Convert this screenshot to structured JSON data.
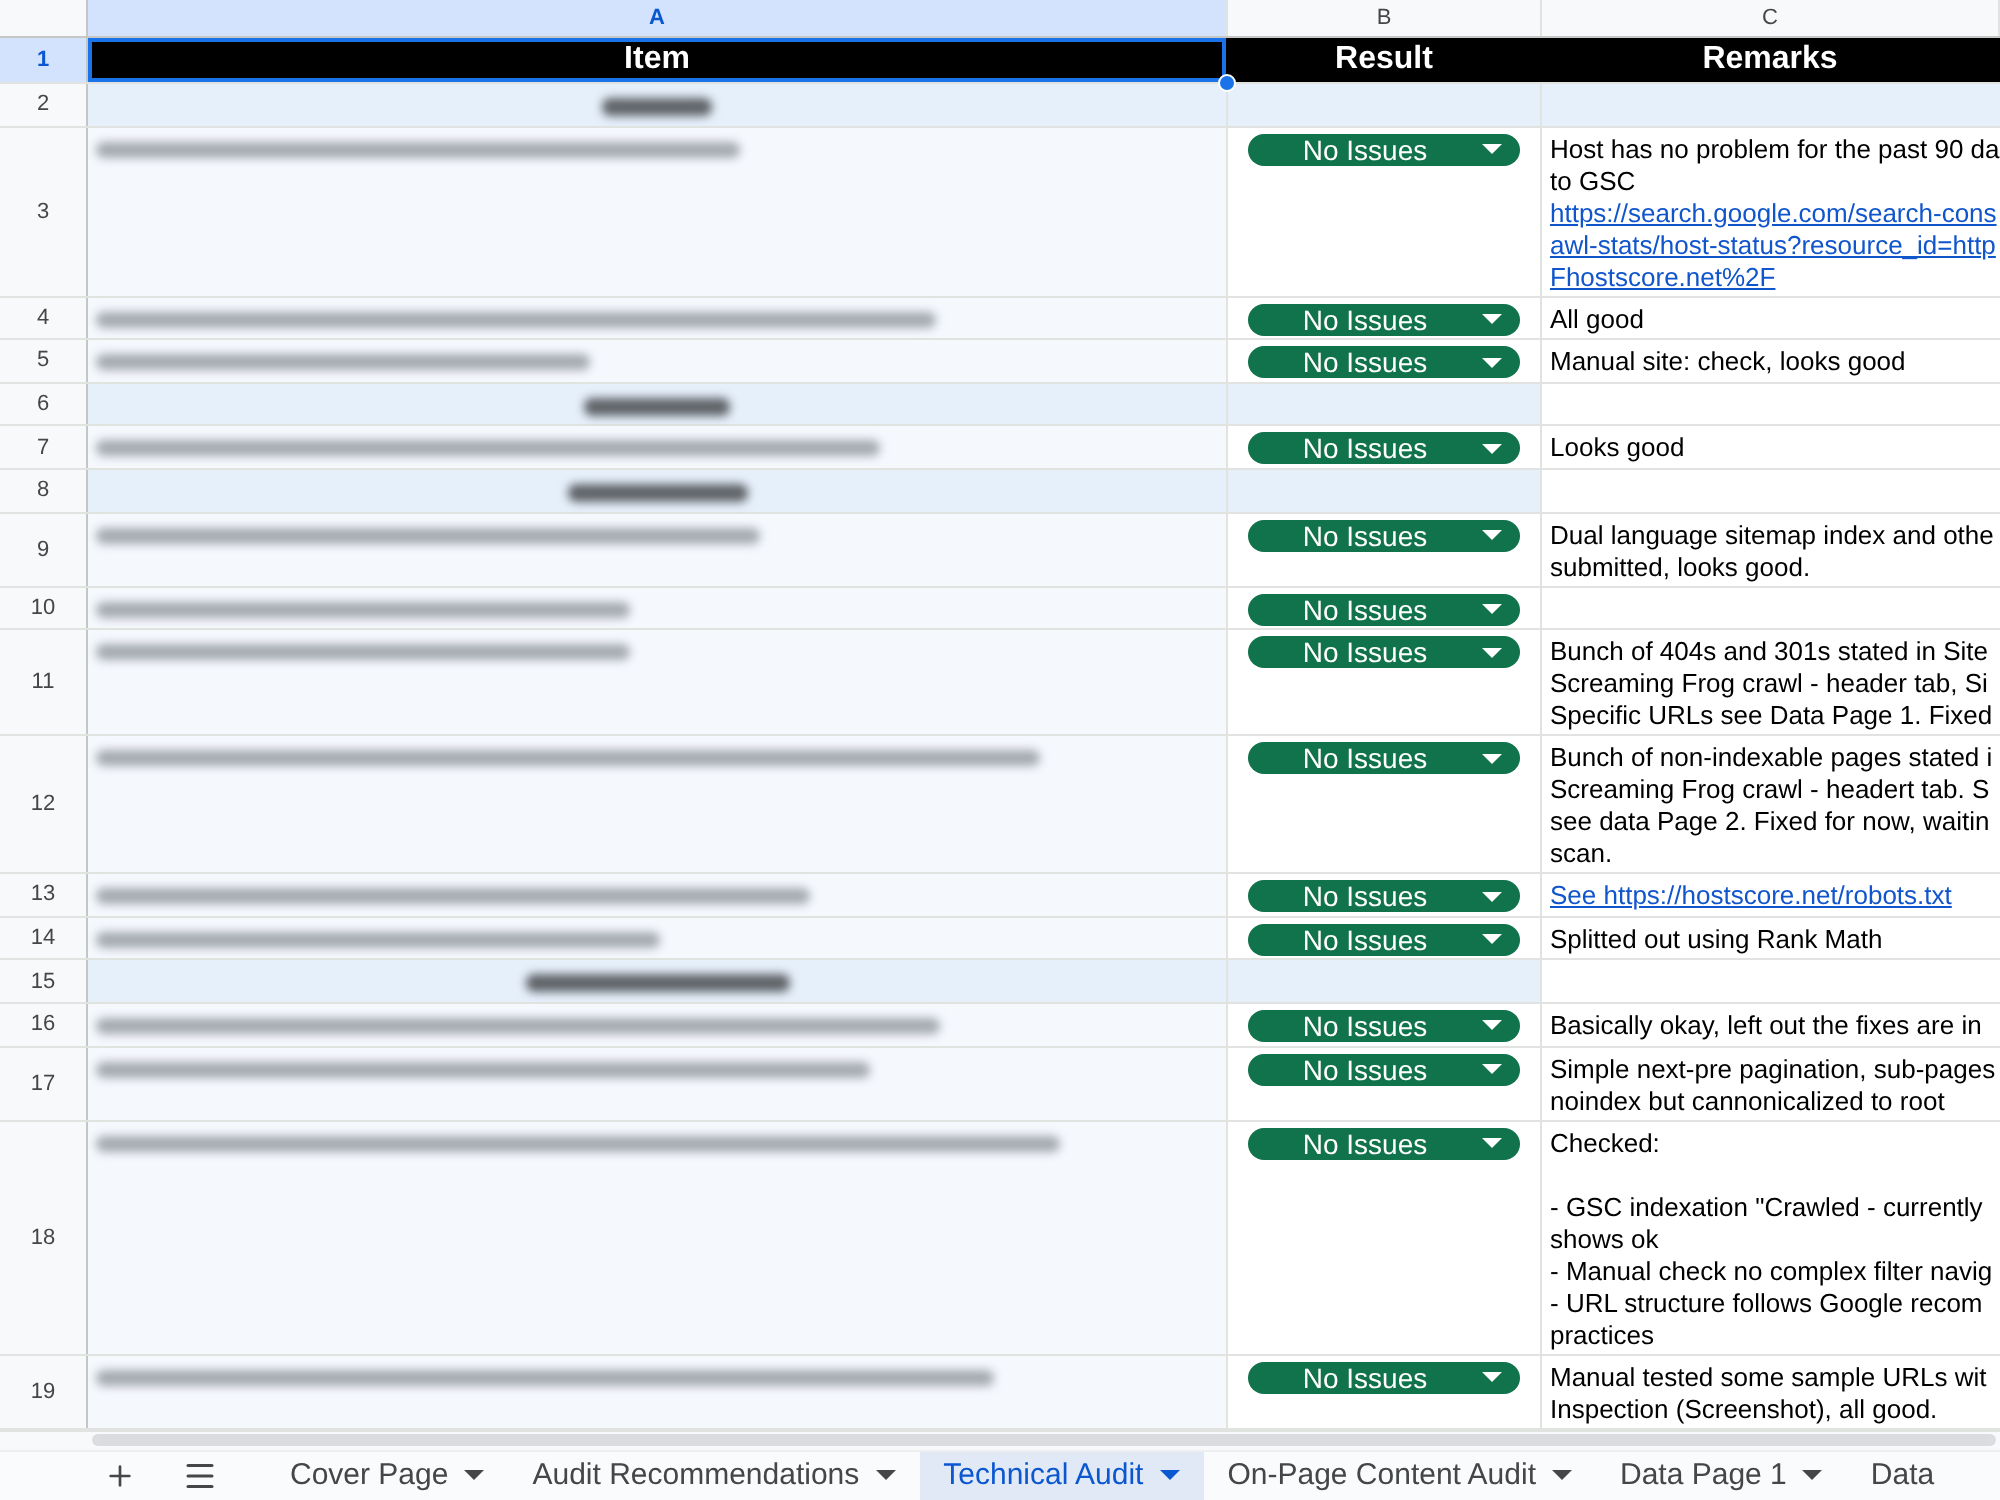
{
  "column_headers": [
    {
      "label": "A",
      "selected": true
    },
    {
      "label": "B",
      "selected": false
    },
    {
      "label": "C",
      "selected": false
    }
  ],
  "rows": [
    {
      "number": "1",
      "kind": "header",
      "selected": true,
      "cells": [
        "Item",
        "Result",
        "Remarks"
      ]
    },
    {
      "number": "2",
      "kind": "section",
      "selected": false,
      "remarks_shaded": true
    },
    {
      "number": "3",
      "kind": "item",
      "selected": false,
      "result": "No Issues",
      "remarks": [
        {
          "kind": "text",
          "lines": [
            "Host has no problem for the past 90 da",
            "to GSC"
          ]
        },
        {
          "kind": "link",
          "lines": [
            "https://search.google.com/search-cons",
            "awl-stats/host-status?resource_id=http",
            "Fhostscore.net%2F"
          ]
        }
      ]
    },
    {
      "number": "4",
      "kind": "item",
      "selected": false,
      "result": "No Issues",
      "remarks": [
        {
          "kind": "text",
          "lines": [
            "All good"
          ]
        }
      ]
    },
    {
      "number": "5",
      "kind": "item",
      "selected": false,
      "result": "No Issues",
      "remarks": [
        {
          "kind": "text",
          "lines": [
            "Manual site: check, looks good"
          ]
        }
      ]
    },
    {
      "number": "6",
      "kind": "section",
      "selected": false,
      "remarks_shaded": false
    },
    {
      "number": "7",
      "kind": "item",
      "selected": false,
      "result": "No Issues",
      "remarks": [
        {
          "kind": "text",
          "lines": [
            "Looks good"
          ]
        }
      ]
    },
    {
      "number": "8",
      "kind": "section",
      "selected": false,
      "remarks_shaded": false
    },
    {
      "number": "9",
      "kind": "item",
      "selected": false,
      "result": "No Issues",
      "remarks": [
        {
          "kind": "text",
          "lines": [
            "Dual language sitemap index and othe",
            "submitted, looks good."
          ]
        }
      ]
    },
    {
      "number": "10",
      "kind": "item",
      "selected": false,
      "result": "No Issues"
    },
    {
      "number": "11",
      "kind": "item",
      "selected": false,
      "result": "No Issues",
      "remarks": [
        {
          "kind": "text",
          "lines": [
            "Bunch of 404s and 301s stated in Site",
            "Screaming Frog crawl - header tab, Si",
            "Specific URLs see Data Page 1. Fixed"
          ]
        }
      ]
    },
    {
      "number": "12",
      "kind": "item",
      "selected": false,
      "result": "No Issues",
      "remarks": [
        {
          "kind": "text",
          "lines": [
            "Bunch of non-indexable pages stated i",
            "Screaming Frog crawl - headert tab. S",
            "see data Page 2. Fixed for now, waitin",
            "scan."
          ]
        }
      ]
    },
    {
      "number": "13",
      "kind": "item",
      "selected": false,
      "result": "No Issues",
      "remarks": [
        {
          "kind": "link",
          "lines": [
            "See https://hostscore.net/robots.txt"
          ]
        }
      ]
    },
    {
      "number": "14",
      "kind": "item",
      "selected": false,
      "result": "No Issues",
      "remarks": [
        {
          "kind": "text",
          "lines": [
            "Splitted out using Rank Math"
          ]
        }
      ]
    },
    {
      "number": "15",
      "kind": "section",
      "selected": false,
      "remarks_shaded": false
    },
    {
      "number": "16",
      "kind": "item",
      "selected": false,
      "result": "No Issues",
      "remarks": [
        {
          "kind": "text",
          "lines": [
            "Basically okay, left out the fixes are in"
          ]
        }
      ]
    },
    {
      "number": "17",
      "kind": "item",
      "selected": false,
      "result": "No Issues",
      "remarks": [
        {
          "kind": "text",
          "lines": [
            "Simple next-pre pagination, sub-pages",
            "noindex but cannonicalized to root"
          ]
        }
      ]
    },
    {
      "number": "18",
      "kind": "item",
      "selected": false,
      "result": "No Issues",
      "remarks": [
        {
          "kind": "text",
          "lines": [
            "Checked:"
          ]
        },
        {
          "kind": "blank"
        },
        {
          "kind": "text",
          "lines": [
            "- GSC indexation \"Crawled - currently",
            "shows ok"
          ]
        },
        {
          "kind": "text",
          "lines": [
            "- Manual check no complex filter navig"
          ]
        },
        {
          "kind": "text",
          "lines": [
            "- URL structure follows Google recom",
            "practices"
          ]
        }
      ]
    },
    {
      "number": "19",
      "kind": "item",
      "selected": false,
      "result": "No Issues",
      "remarks": [
        {
          "kind": "text",
          "lines": [
            "Manual tested some sample URLs wit",
            "Inspection (Screenshot), all good."
          ]
        }
      ]
    }
  ],
  "sheet_tabs": [
    {
      "label": "Cover Page",
      "selected": false,
      "dropdown": true
    },
    {
      "label": "Audit Recommendations",
      "selected": false,
      "dropdown": true
    },
    {
      "label": "Technical Audit",
      "selected": true,
      "dropdown": true
    },
    {
      "label": "On-Page Content Audit",
      "selected": false,
      "dropdown": true
    },
    {
      "label": "Data Page 1",
      "selected": false,
      "dropdown": true
    },
    {
      "label": "Data",
      "selected": false,
      "dropdown": false
    }
  ]
}
